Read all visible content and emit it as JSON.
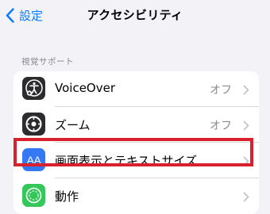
{
  "navbar": {
    "back_label": "設定",
    "title": "アクセシビリティ"
  },
  "section": {
    "header": "視覚サポート",
    "rows": [
      {
        "label": "VoiceOver",
        "value": "オフ",
        "icon": "voiceover-icon",
        "icon_color": "#2c2c2e"
      },
      {
        "label": "ズーム",
        "value": "オフ",
        "icon": "zoom-icon",
        "icon_color": "#2c2c2e"
      },
      {
        "label": "画面表示とテキストサイズ",
        "value": "",
        "icon": "text-size-icon",
        "icon_text": "AA",
        "icon_color": "#3478f6"
      },
      {
        "label": "動作",
        "value": "",
        "icon": "motion-icon",
        "icon_color": "#34c759"
      }
    ]
  },
  "highlight_color": "#d9212e"
}
